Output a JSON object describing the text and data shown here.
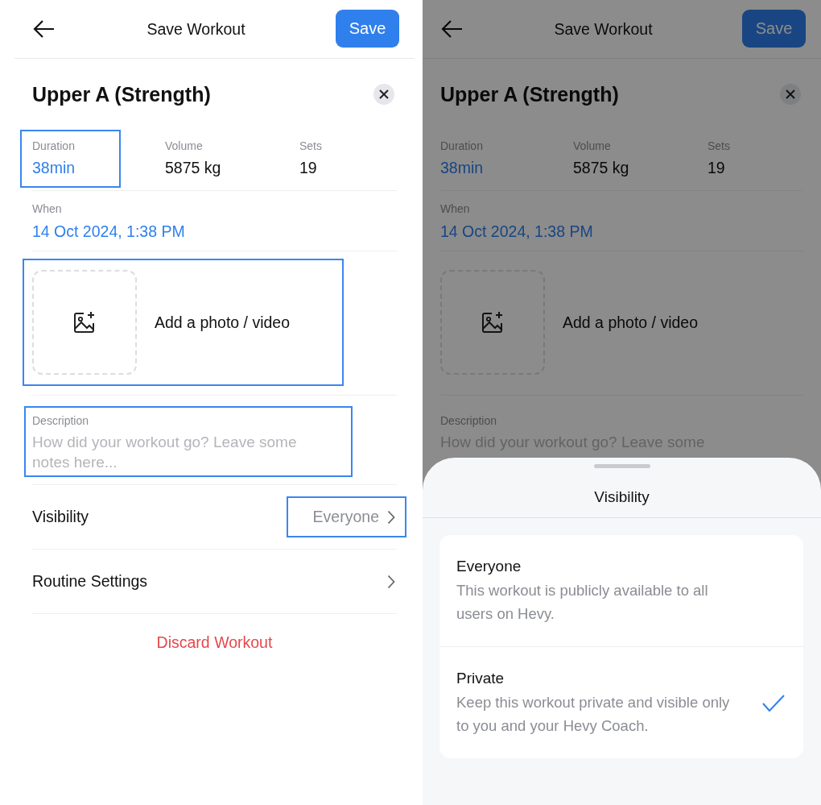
{
  "screens": [
    {
      "dimmed": false,
      "header": {
        "title": "Save Workout",
        "save": "Save"
      },
      "workout_title": "Upper A (Strength)",
      "stats": [
        {
          "label": "Duration",
          "value": "38min",
          "accent": true,
          "highlighted": true
        },
        {
          "label": "Volume",
          "value": "5875 kg",
          "accent": false,
          "highlighted": false
        },
        {
          "label": "Sets",
          "value": "19",
          "accent": false,
          "highlighted": false
        }
      ],
      "when": {
        "label": "When",
        "value": "14 Oct 2024, 1:38 PM"
      },
      "media": {
        "label": "Add a photo / video",
        "highlighted": true
      },
      "description": {
        "label": "Description",
        "placeholder": "How did your workout go? Leave some notes here...",
        "highlighted": true
      },
      "rows": [
        {
          "label": "Visibility",
          "value": "Everyone",
          "highlighted": true
        },
        {
          "label": "Routine Settings",
          "highlighted": false
        }
      ],
      "discard": "Discard Workout"
    },
    {
      "dimmed": true,
      "header": {
        "title": "Save Workout",
        "save": "Save"
      },
      "workout_title": "Upper A (Strength)",
      "stats": [
        {
          "label": "Duration",
          "value": "38min",
          "accent": true,
          "highlighted": false
        },
        {
          "label": "Volume",
          "value": "5875 kg",
          "accent": false,
          "highlighted": false
        },
        {
          "label": "Sets",
          "value": "19",
          "accent": false,
          "highlighted": false
        }
      ],
      "when": {
        "label": "When",
        "value": "14 Oct 2024, 1:38 PM"
      },
      "media": {
        "label": "Add a photo / video",
        "highlighted": false
      },
      "description": {
        "label": "Description",
        "placeholder": "How did your workout go? Leave some",
        "highlighted": false
      },
      "sheet": {
        "title": "Visibility",
        "options": [
          {
            "title": "Everyone",
            "description": "This workout is publicly available to all users on Hevy.",
            "selected": false
          },
          {
            "title": "Private",
            "description": "Keep this workout private and visible only to you and your Hevy Coach.",
            "selected": true
          }
        ]
      }
    }
  ]
}
